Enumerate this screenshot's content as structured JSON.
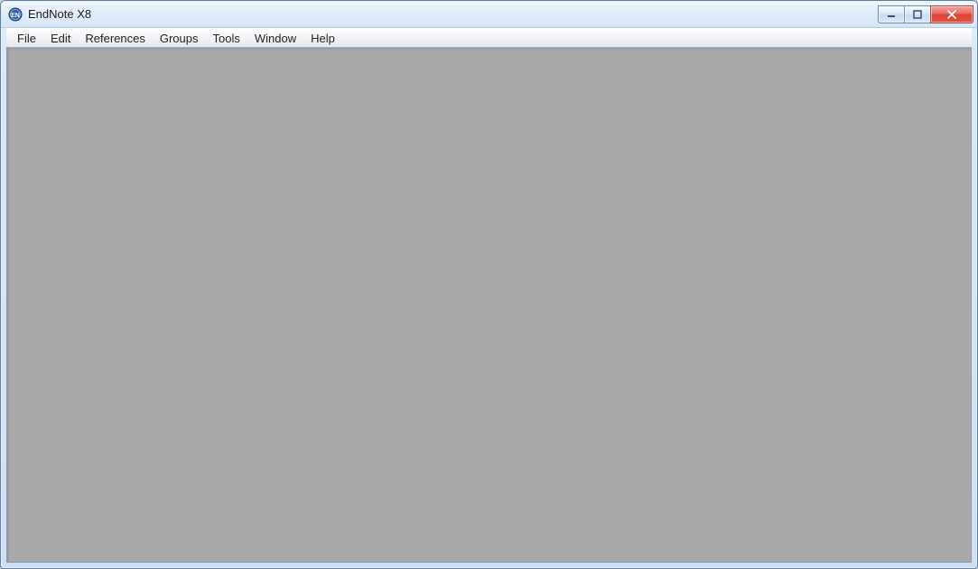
{
  "window": {
    "title": "EndNote X8"
  },
  "menu": {
    "items": [
      "File",
      "Edit",
      "References",
      "Groups",
      "Tools",
      "Window",
      "Help"
    ]
  }
}
